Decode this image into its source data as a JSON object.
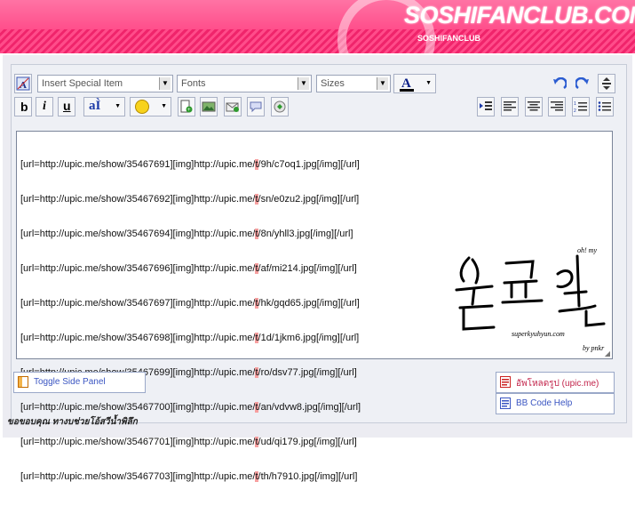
{
  "banner": {
    "logo_text": "SOSHIFANCLUB.COM",
    "sub_text": "SOSHIFANCLUB"
  },
  "toolbar": {
    "special_item": "Insert Special Item",
    "fonts": "Fonts",
    "sizes": "Sizes",
    "bold": "b",
    "italic": "i",
    "underline": "u",
    "text_color": "A"
  },
  "editor": {
    "lines": [
      {
        "pre": "[url=http://upic.me/show/35467691][img]http://upic.me/",
        "hl": "t",
        "post": "/9h/c7oq1.jpg[/img][/url]"
      },
      {
        "pre": "[url=http://upic.me/show/35467692][img]http://upic.me/",
        "hl": "t",
        "post": "/sn/e0zu2.jpg[/img][/url]"
      },
      {
        "pre": "[url=http://upic.me/show/35467694][img]http://upic.me/",
        "hl": "t",
        "post": "/8n/yhll3.jpg[/img][/url]"
      },
      {
        "pre": "[url=http://upic.me/show/35467696][img]http://upic.me/",
        "hl": "t",
        "post": "/af/mi214.jpg[/img][/url]"
      },
      {
        "pre": "[url=http://upic.me/show/35467697][img]http://upic.me/",
        "hl": "t",
        "post": "/hk/gqd65.jpg[/img][/url]"
      },
      {
        "pre": "[url=http://upic.me/show/35467698][img]http://upic.me/",
        "hl": "t",
        "post": "/1d/1jkm6.jpg[/img][/url]"
      },
      {
        "pre": "[url=http://upic.me/show/35467699][img]http://upic.me/",
        "hl": "t",
        "post": "/ro/dsv77.jpg[/img][/url]"
      },
      {
        "pre": "[url=http://upic.me/show/35467700][img]http://upic.me/",
        "hl": "t",
        "post": "/an/vdvw8.jpg[/img][/url]"
      },
      {
        "pre": "[url=http://upic.me/show/35467701][img]http://upic.me/",
        "hl": "t",
        "post": "/ud/qi179.jpg[/img][/url]"
      },
      {
        "pre": "[url=http://upic.me/show/35467703][img]http://upic.me/",
        "hl": "t",
        "post": "/th/h7910.jpg[/img][/url]"
      }
    ]
  },
  "signature": {
    "small_top": "oh! my",
    "site": "superkyuhyun.com",
    "byline": "by pnkr"
  },
  "buttons": {
    "toggle_side_panel": "Toggle Side Panel",
    "upload": "อัพโหลดรูป (upic.me)",
    "bbcode_help": "BB Code Help"
  },
  "footer": {
    "text": "ขอขอบคุณ ทางบช่วยโอ้สวีน้ำพิลึก"
  },
  "colors": {
    "banner": "#f0246b",
    "link": "#3a55c2",
    "highlight": "#f7a0a0"
  }
}
